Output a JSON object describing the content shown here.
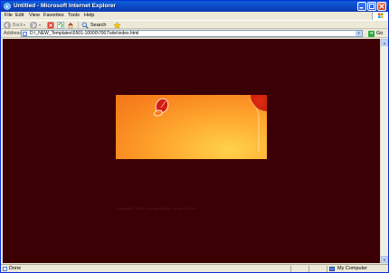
{
  "window": {
    "title": "Untitled - Microsoft Internet Explorer"
  },
  "menubar": {
    "items": [
      "File",
      "Edit",
      "View",
      "Favorites",
      "Tools",
      "Help"
    ]
  },
  "toolbar": {
    "back_label": "Back",
    "search_label": "Search"
  },
  "address": {
    "label": "Address",
    "url": "D:\\_NEW_Templates\\5501-10000\\7067\\site\\index.html",
    "go_label": "Go"
  },
  "page": {
    "footer": "Copyright © 2004 • Privacy Policy • Terms Of Use"
  },
  "status": {
    "text": "Done",
    "zone": "My Computer"
  },
  "colors": {
    "page_background": "#3a0003",
    "banner_orange": "#ffa92f",
    "banner_red": "#b3140a"
  }
}
